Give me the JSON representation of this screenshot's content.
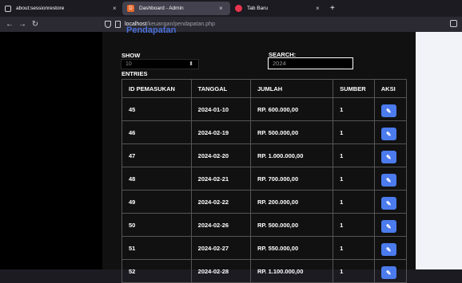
{
  "browser": {
    "tabs": [
      {
        "title": "about:sessionrestore",
        "close": "×"
      },
      {
        "title": "Dashboard - Admin",
        "close": "×",
        "favicon_letter": "D"
      },
      {
        "title": "Tab Baru",
        "close": "×"
      }
    ],
    "new_tab": "+",
    "url_host": "localhost",
    "url_path": "/keuangan/pendapatan.php"
  },
  "page": {
    "heading": "Pendapatan",
    "show_label": "SHOW",
    "entries_label": "ENTRIES",
    "entries_value": "10",
    "search_label": "SEARCH:",
    "search_value": "2024",
    "columns": [
      "ID PEMASUKAN",
      "TANGGAL",
      "JUMLAH",
      "SUMBER",
      "AKSI"
    ],
    "rows": [
      {
        "id": "45",
        "date": "2024-01-10",
        "amount": "RP. 600.000,00",
        "source": "1"
      },
      {
        "id": "46",
        "date": "2024-02-19",
        "amount": "RP. 500.000,00",
        "source": "1"
      },
      {
        "id": "47",
        "date": "2024-02-20",
        "amount": "RP. 1.000.000,00",
        "source": "1"
      },
      {
        "id": "48",
        "date": "2024-02-21",
        "amount": "RP. 700.000,00",
        "source": "1"
      },
      {
        "id": "49",
        "date": "2024-02-22",
        "amount": "RP. 200.000,00",
        "source": "1"
      },
      {
        "id": "50",
        "date": "2024-02-26",
        "amount": "RP. 500.000,00",
        "source": "1"
      },
      {
        "id": "51",
        "date": "2024-02-27",
        "amount": "RP. 550.000,00",
        "source": "1"
      },
      {
        "id": "52",
        "date": "2024-02-28",
        "amount": "RP. 1.100.000,00",
        "source": "1"
      }
    ]
  },
  "colors": {
    "accent": "#4b7bec",
    "content_bg": "#111111",
    "sidebar_bg": "#000000"
  }
}
